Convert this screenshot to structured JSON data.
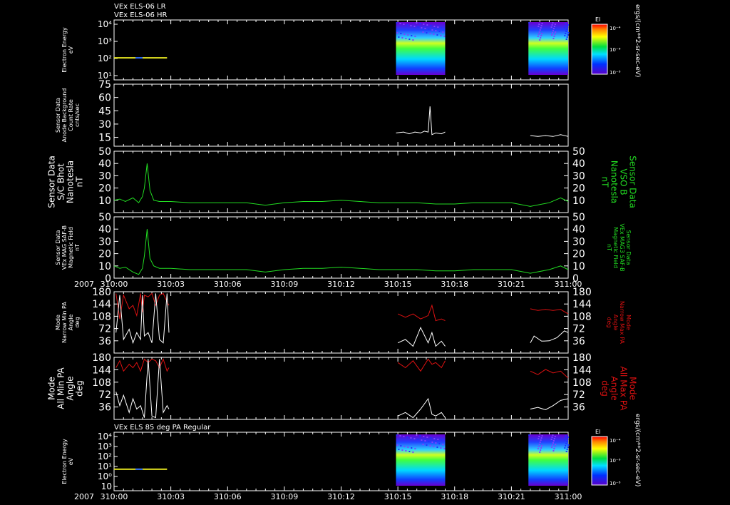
{
  "header": {
    "line1": "VEx ELS-06 LR",
    "line2": "VEx ELS-06 HR"
  },
  "colors": {
    "background": "#000000",
    "axis": "#ffffff",
    "white_trace": "#ffffff",
    "green_trace": "#22dd22",
    "red_trace": "#dd1111"
  },
  "time_axis": {
    "year": "2007",
    "ticks": [
      "310:00",
      "310:03",
      "310:06",
      "310:09",
      "310:12",
      "310:15",
      "310:18",
      "310:21",
      "311:00"
    ],
    "range_minutes": [
      0,
      24
    ]
  },
  "colorbar": {
    "title": "El",
    "tick_labels": [
      "10⁻⁴",
      "10⁻⁶",
      "10⁻⁸"
    ],
    "units": "ergs/(cm**2-sr-sec-eV)"
  },
  "chart_data": [
    {
      "id": "p1",
      "type": "heatmap",
      "ylabel": [
        "Electron Energy",
        "eV"
      ],
      "ytick_labels": [
        "10⁴",
        "10³",
        "10²",
        "10¹"
      ],
      "ylog": true,
      "x_minutes_blocks": [
        [
          0,
          2.8
        ],
        [
          14.9,
          17.5
        ],
        [
          21.9,
          24
        ]
      ]
    },
    {
      "id": "p2",
      "type": "line",
      "ylabel": [
        "Sensor Data",
        "Anode Background",
        "Count Rate",
        "cnts/sec"
      ],
      "ylim": [
        5,
        75
      ],
      "yticks": [
        15,
        30,
        45,
        60,
        75
      ],
      "series": [
        {
          "color": "white",
          "x": [
            14.9,
            15.3,
            15.6,
            15.9,
            16.2,
            16.4,
            16.6,
            16.7,
            16.8,
            17.0,
            17.3,
            17.5
          ],
          "y": [
            20,
            21,
            19,
            21,
            20,
            22,
            21,
            50,
            18,
            20,
            19,
            21
          ]
        },
        {
          "color": "white",
          "x": [
            22.0,
            22.4,
            22.8,
            23.2,
            23.6,
            24.0
          ],
          "y": [
            17,
            16,
            17,
            16,
            18,
            16
          ]
        }
      ]
    },
    {
      "id": "p3",
      "type": "line",
      "ylabel": [
        "Sensor Data",
        "S/C Bhot",
        "Nanotesla",
        "nT"
      ],
      "ylabel_right": [
        "Sensor Data",
        "VSO B",
        "Nanotesla",
        "nT"
      ],
      "ylim": [
        0,
        50
      ],
      "yticks": [
        10,
        20,
        30,
        40,
        50
      ],
      "series": [
        {
          "color": "green",
          "x": [
            0,
            0.3,
            0.6,
            1.0,
            1.3,
            1.5,
            1.6,
            1.75,
            1.9,
            2.1,
            2.4,
            3,
            4,
            5,
            6,
            7,
            8,
            9,
            10,
            11,
            12,
            13,
            14,
            15,
            16,
            17,
            18,
            19,
            20,
            21,
            22,
            23,
            23.6,
            24
          ],
          "y": [
            10,
            11,
            9,
            12,
            8,
            13,
            20,
            40,
            18,
            10,
            9,
            9,
            8,
            8,
            8,
            8,
            6,
            8,
            9,
            9,
            10,
            9,
            8,
            8,
            8,
            7,
            7,
            8,
            8,
            8,
            5,
            8,
            12,
            9
          ]
        }
      ]
    },
    {
      "id": "p4",
      "type": "line",
      "ylabel": [
        "Sensor Data",
        "VEx MAG SAF-B",
        "Magnetic Field",
        "nT"
      ],
      "ylabel_right": [
        "Sensor Data",
        "VEx MAG3 SAF-B",
        "Magnetic Field",
        "nT"
      ],
      "ylim": [
        0,
        50
      ],
      "yticks": [
        0,
        10,
        20,
        30,
        40,
        50
      ],
      "series": [
        {
          "color": "green",
          "x": [
            0,
            0.3,
            0.6,
            1.0,
            1.3,
            1.5,
            1.6,
            1.75,
            1.9,
            2.1,
            2.4,
            3,
            4,
            5,
            6,
            7,
            8,
            9,
            10,
            11,
            12,
            13,
            14,
            15,
            16,
            17,
            18,
            19,
            20,
            21,
            22,
            23,
            23.6,
            24
          ],
          "y": [
            10,
            8,
            9,
            5,
            3,
            8,
            18,
            40,
            16,
            10,
            8,
            8,
            7,
            7,
            7,
            7,
            5,
            7,
            8,
            8,
            9,
            8,
            7,
            7,
            7,
            6,
            6,
            7,
            7,
            7,
            4,
            7,
            10,
            7
          ]
        }
      ]
    },
    {
      "id": "p5",
      "type": "line",
      "ylabel": [
        "Mode",
        "Narrow Min PA",
        "Angle",
        "deg"
      ],
      "ylabel_right": [
        "Mode",
        "Narrow Max PA",
        "Angle",
        "deg"
      ],
      "ylim": [
        0,
        180
      ],
      "yticks": [
        36,
        72,
        108,
        144,
        180
      ],
      "series": [
        {
          "color": "red",
          "x": [
            0.1,
            0.3,
            0.5,
            0.8,
            1.0,
            1.2,
            1.4,
            1.5,
            1.6,
            1.8,
            2.0,
            2.2,
            2.4,
            2.6,
            2.8,
            2.9
          ],
          "y": [
            175,
            100,
            170,
            130,
            140,
            110,
            175,
            120,
            170,
            165,
            175,
            140,
            170,
            175,
            150,
            140
          ]
        },
        {
          "color": "white",
          "x": [
            0.1,
            0.3,
            0.5,
            0.8,
            1.0,
            1.2,
            1.4,
            1.5,
            1.6,
            1.8,
            2.0,
            2.2,
            2.4,
            2.6,
            2.8,
            2.9
          ],
          "y": [
            60,
            170,
            40,
            70,
            30,
            60,
            40,
            170,
            50,
            60,
            30,
            175,
            40,
            30,
            175,
            60
          ]
        },
        {
          "color": "red",
          "x": [
            15.0,
            15.4,
            15.8,
            16.2,
            16.6,
            16.8,
            17.0,
            17.3,
            17.5
          ],
          "y": [
            115,
            105,
            115,
            100,
            110,
            140,
            95,
            100,
            95
          ]
        },
        {
          "color": "white",
          "x": [
            15.0,
            15.4,
            15.8,
            16.2,
            16.6,
            16.8,
            17.0,
            17.3,
            17.5
          ],
          "y": [
            30,
            40,
            20,
            75,
            30,
            60,
            20,
            35,
            20
          ]
        },
        {
          "color": "red",
          "x": [
            22.0,
            22.4,
            22.8,
            23.2,
            23.6,
            24.0
          ],
          "y": [
            130,
            125,
            128,
            125,
            128,
            115
          ]
        },
        {
          "color": "white",
          "x": [
            22.0,
            22.2,
            22.6,
            23.0,
            23.4,
            23.8,
            24.0
          ],
          "y": [
            30,
            50,
            35,
            36,
            45,
            65,
            60
          ]
        }
      ]
    },
    {
      "id": "p6",
      "type": "line",
      "ylabel": [
        "Mode",
        "All Min PA",
        "Angle",
        "deg"
      ],
      "ylabel_right": [
        "Mode",
        "All Max PA",
        "Angle",
        "deg"
      ],
      "ylim": [
        0,
        180
      ],
      "yticks": [
        36,
        72,
        108,
        144,
        180
      ],
      "series": [
        {
          "color": "red",
          "x": [
            0.1,
            0.3,
            0.5,
            0.8,
            1.0,
            1.2,
            1.4,
            1.6,
            1.8,
            2.0,
            2.2,
            2.4,
            2.6,
            2.8,
            2.9
          ],
          "y": [
            150,
            170,
            140,
            160,
            150,
            165,
            140,
            175,
            165,
            175,
            170,
            150,
            175,
            140,
            150
          ]
        },
        {
          "color": "white",
          "x": [
            0.1,
            0.3,
            0.5,
            0.8,
            1.0,
            1.2,
            1.4,
            1.6,
            1.8,
            2.0,
            2.2,
            2.4,
            2.6,
            2.8,
            2.9
          ],
          "y": [
            80,
            40,
            70,
            20,
            60,
            30,
            40,
            5,
            175,
            10,
            5,
            175,
            20,
            40,
            30
          ]
        },
        {
          "color": "red",
          "x": [
            15.0,
            15.4,
            15.8,
            16.2,
            16.6,
            16.8,
            17.0,
            17.3,
            17.5
          ],
          "y": [
            165,
            150,
            170,
            140,
            175,
            160,
            165,
            150,
            170
          ]
        },
        {
          "color": "white",
          "x": [
            15.0,
            15.4,
            15.8,
            16.2,
            16.6,
            16.8,
            17.0,
            17.3,
            17.5
          ],
          "y": [
            10,
            20,
            5,
            30,
            60,
            15,
            10,
            20,
            5
          ]
        },
        {
          "color": "red",
          "x": [
            22.0,
            22.4,
            22.8,
            23.2,
            23.6,
            24.0
          ],
          "y": [
            140,
            130,
            145,
            135,
            140,
            120
          ]
        },
        {
          "color": "white",
          "x": [
            22.0,
            22.4,
            22.8,
            23.2,
            23.6,
            24.0
          ],
          "y": [
            30,
            35,
            28,
            40,
            55,
            60
          ]
        }
      ]
    },
    {
      "id": "p7",
      "type": "heatmap",
      "title": "VEx ELS 85 deg PA Regular",
      "ylabel": [
        "Electron Energy",
        "eV"
      ],
      "ytick_labels": [
        "10⁴",
        "10³",
        "10²",
        "10¹",
        "10⁰",
        "10"
      ],
      "ylog": true,
      "x_minutes_blocks": [
        [
          0,
          2.8
        ],
        [
          14.9,
          17.5
        ],
        [
          21.9,
          24
        ]
      ]
    }
  ]
}
